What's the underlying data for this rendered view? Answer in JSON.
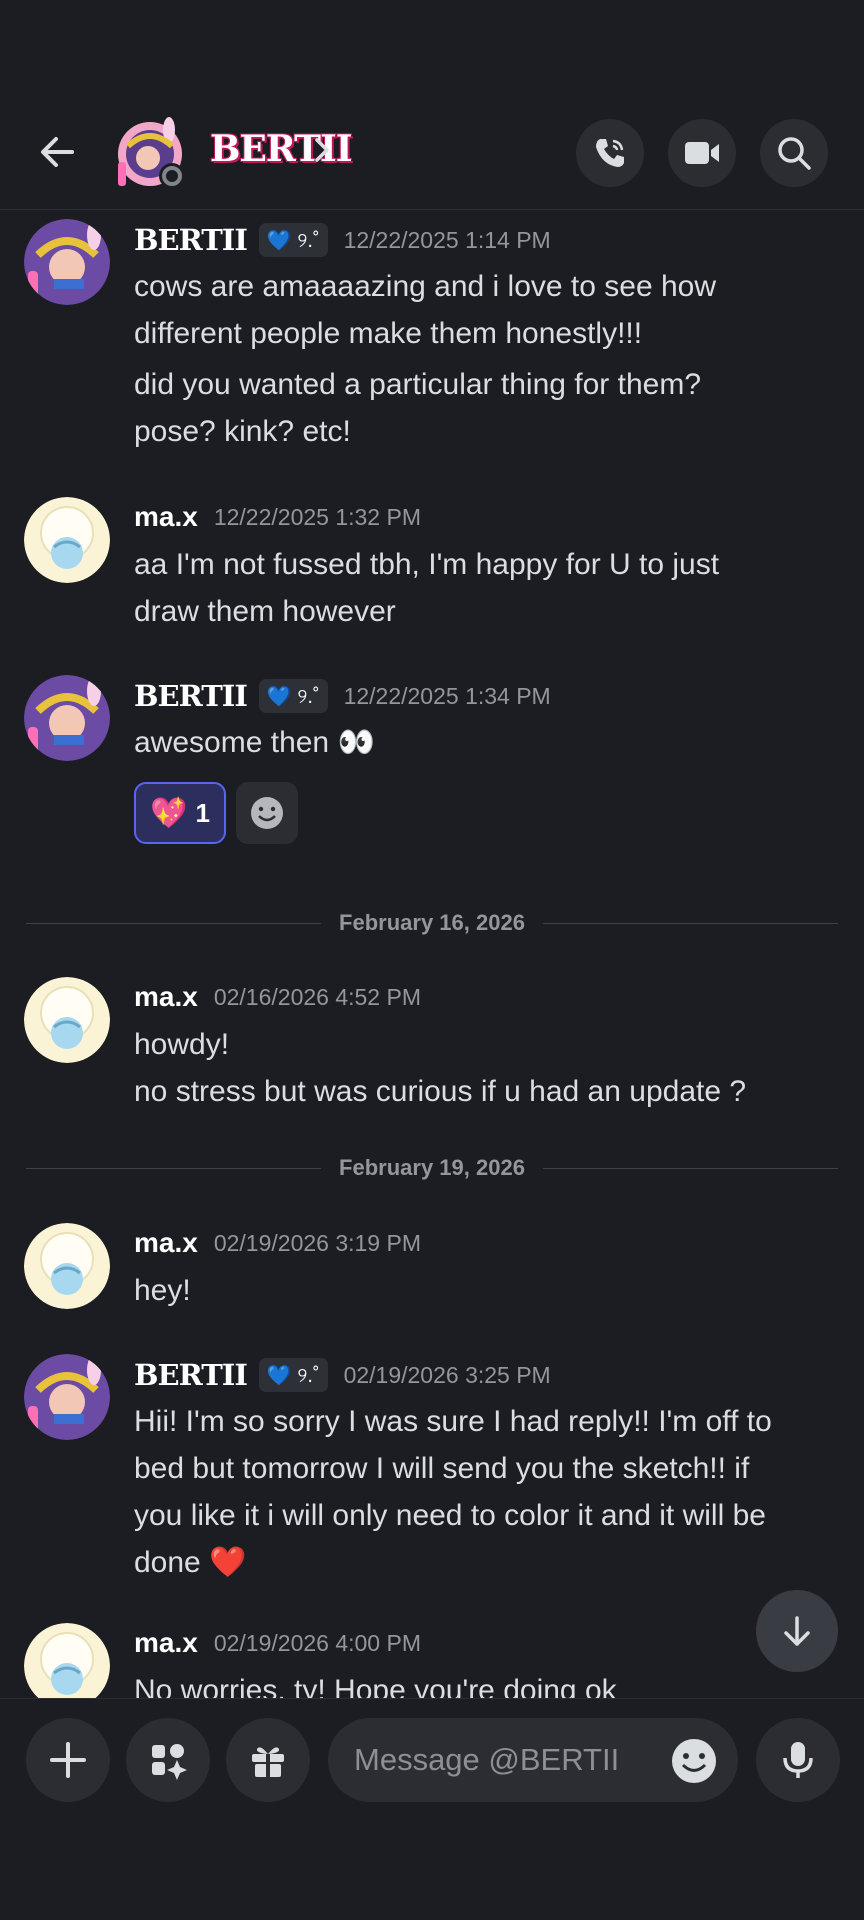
{
  "header": {
    "name": "BERTII"
  },
  "messages": [
    {
      "author": "BERTII",
      "tag": "💙 ୨.˚",
      "timestamp": "12/22/2025 1:14 PM",
      "lines": [
        "cows are amaaaazing and i love to see how",
        "different people make them honestly!!!",
        "did you wanted a particular thing for them?",
        "pose? kink? etc!"
      ]
    },
    {
      "author": "ma.x",
      "timestamp": "12/22/2025 1:32 PM",
      "lines": [
        "aa I'm not fussed tbh, I'm happy for U to just",
        "draw them however"
      ]
    },
    {
      "author": "BERTII",
      "tag": "💙 ୨.˚",
      "timestamp": "12/22/2025 1:34 PM",
      "lines": [
        "awesome then 👀"
      ],
      "reaction": {
        "emoji": "💖",
        "count": "1"
      }
    },
    {
      "author": "ma.x",
      "timestamp": "02/16/2026 4:52 PM",
      "lines": [
        "howdy!",
        "no stress but was curious if u had an update ?"
      ]
    },
    {
      "author": "ma.x",
      "timestamp": "02/19/2026 3:19 PM",
      "lines": [
        "hey!"
      ]
    },
    {
      "author": "BERTII",
      "tag": "💙 ୨.˚",
      "timestamp": "02/19/2026 3:25 PM",
      "lines": [
        "Hii! I'm so sorry I was sure I had reply!! I'm off to",
        "bed but tomorrow I will send you the sketch!! if",
        "you like it i will only need to color it and it will be",
        "done ❤️"
      ]
    },
    {
      "author": "ma.x",
      "timestamp": "02/19/2026 4:00 PM",
      "lines": [
        "No worries, ty! Hope you're doing ok"
      ]
    }
  ],
  "dividers": [
    "February 16, 2026",
    "February 19, 2026"
  ],
  "composer": {
    "placeholder": "Message @BERTII"
  },
  "colors": {
    "background": "#1c1d22",
    "button": "#2b2d33",
    "reaction_border": "#5865f2",
    "reaction_bg": "#2c2f5e"
  }
}
